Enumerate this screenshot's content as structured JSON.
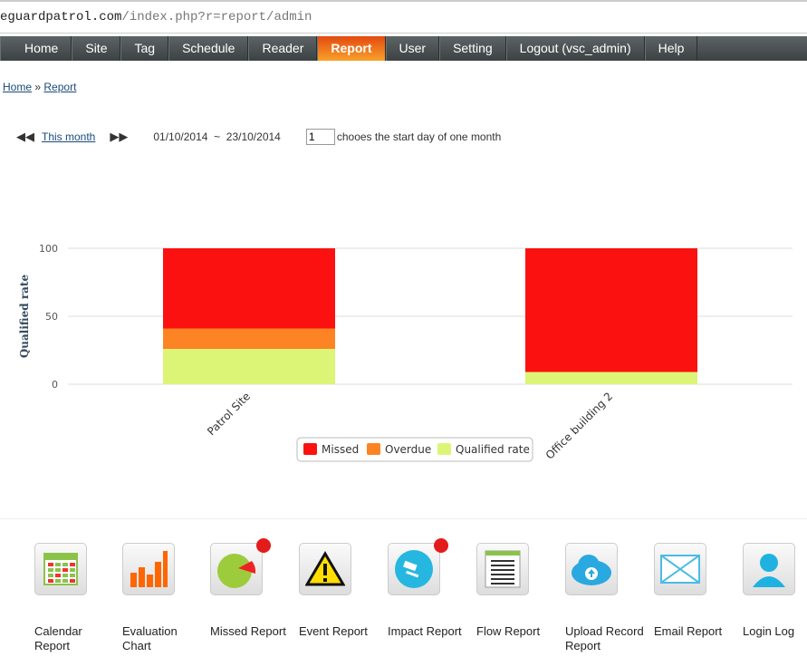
{
  "url": {
    "host": "eguardpatrol.com",
    "path": "/index.php?r=report/admin"
  },
  "nav": [
    "Home",
    "Site",
    "Tag",
    "Schedule",
    "Reader",
    "Report",
    "User",
    "Setting",
    "Logout (vsc_admin)",
    "Help"
  ],
  "nav_active": "Report",
  "breadcrumb": {
    "home": "Home",
    "sep": "»",
    "current": "Report"
  },
  "period": {
    "link": "This month",
    "from": "01/10/2014",
    "tilde": "~",
    "to": "23/10/2014",
    "start_day": "1",
    "start_day_label": "chooes the start day of one month"
  },
  "chart_data": {
    "type": "bar",
    "stacked": true,
    "categories": [
      "Patrol Site",
      "Office building 2"
    ],
    "ylabel": "Qualified rate",
    "ylim": [
      0,
      100
    ],
    "yticks": [
      0,
      50,
      100
    ],
    "series": [
      {
        "name": "Qualified rate",
        "color": "#dcf577",
        "values": [
          26,
          9
        ]
      },
      {
        "name": "Overdue",
        "color": "#fc8424",
        "values": [
          15,
          0
        ]
      },
      {
        "name": "Missed",
        "color": "#fc1111",
        "values": [
          59,
          91
        ]
      }
    ],
    "legend": [
      "Missed",
      "Overdue",
      "Qualified rate"
    ],
    "legend_position": "bottom-center"
  },
  "reports": [
    {
      "label": "Calendar Report",
      "icon": "calendar-icon"
    },
    {
      "label": "Evaluation Chart",
      "icon": "bar-chart-icon"
    },
    {
      "label": "Missed Report",
      "icon": "pie-chart-icon",
      "badge": true
    },
    {
      "label": "Event Report",
      "icon": "warning-icon"
    },
    {
      "label": "Impact Report",
      "icon": "gavel-icon",
      "badge": true
    },
    {
      "label": "Flow Report",
      "icon": "list-icon"
    },
    {
      "label": "Upload Record Report",
      "icon": "cloud-upload-icon"
    },
    {
      "label": "Email Report",
      "icon": "envelope-icon"
    },
    {
      "label": "Login Log",
      "icon": "user-icon"
    }
  ]
}
